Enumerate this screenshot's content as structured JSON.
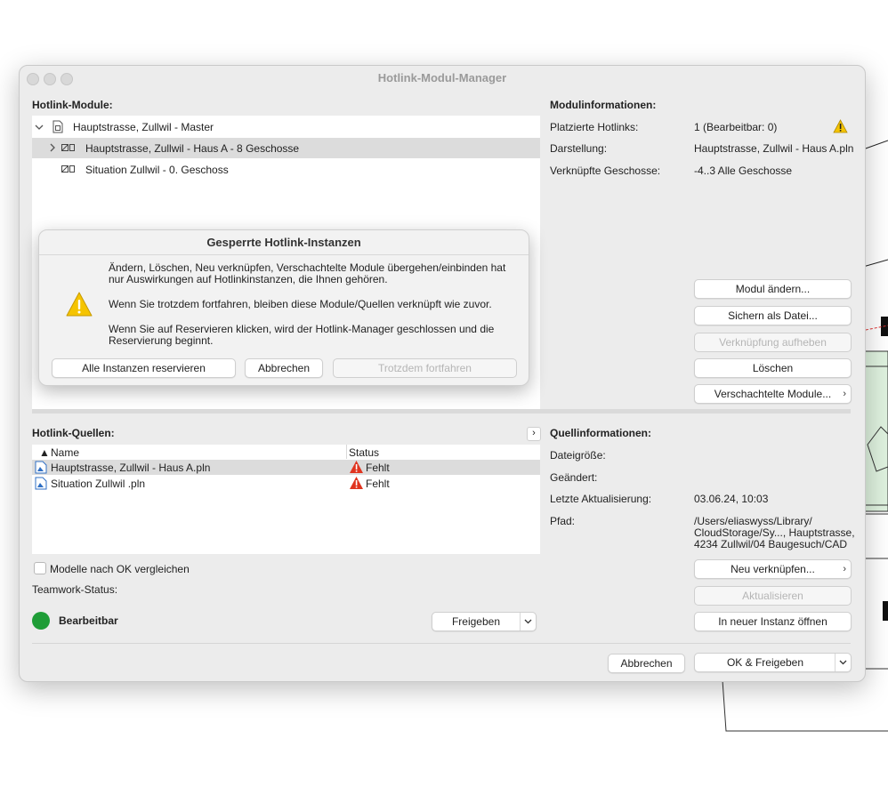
{
  "window": {
    "title": "Hotlink-Modul-Manager"
  },
  "modules": {
    "label": "Hotlink-Module:",
    "items": [
      {
        "name": "Hauptstrasse, Zullwil - Master"
      },
      {
        "name": "Hauptstrasse, Zullwil - Haus A - 8 Geschosse"
      },
      {
        "name": "Situation Zullwil  - 0. Geschoss"
      }
    ]
  },
  "module_info": {
    "label": "Modulinformationen:",
    "rows": [
      {
        "key": "Platzierte Hotlinks:",
        "value": "1 (Bearbeitbar: 0)"
      },
      {
        "key": "Darstellung:",
        "value": "Hauptstrasse, Zullwil - Haus A.pln"
      },
      {
        "key": "Verknüpfte Geschosse:",
        "value": "-4..3 Alle Geschosse"
      }
    ],
    "buttons": {
      "change": "Modul ändern...",
      "save": "Sichern als Datei...",
      "unlink": "Verknüpfung aufheben",
      "delete": "Löschen",
      "nested": "Verschachtelte Module..."
    }
  },
  "dialog": {
    "title": "Gesperrte Hotlink-Instanzen",
    "p1": "Ändern, Löschen, Neu verknüpfen, Verschachtelte Module übergehen/einbinden hat nur Auswirkungen auf Hotlinkinstanzen, die Ihnen gehören.",
    "p2": "Wenn Sie trotzdem fortfahren, bleiben diese Module/Quellen verknüpft wie zuvor.",
    "p3": "Wenn Sie auf Reservieren klicken, wird der Hotlink-Manager geschlossen und die Reservierung beginnt.",
    "btn_reserve": "Alle Instanzen reservieren",
    "btn_cancel": "Abbrechen",
    "btn_continue": "Trotzdem fortfahren"
  },
  "sources": {
    "label": "Hotlink-Quellen:",
    "col_name": "Name",
    "col_status": "Status",
    "rows": [
      {
        "name": "Hauptstrasse, Zullwil - Haus A.pln",
        "status": "Fehlt"
      },
      {
        "name": "Situation Zullwil .pln",
        "status": "Fehlt"
      }
    ],
    "compare_label": "Modelle nach OK vergleichen",
    "teamwork_label": "Teamwork-Status:",
    "status_text": "Bearbeitbar",
    "release_btn": "Freigeben"
  },
  "source_info": {
    "label": "Quellinformationen:",
    "size_key": "Dateigröße:",
    "changed_key": "Geändert:",
    "update_key": "Letzte Aktualisierung:",
    "update_value": "03.06.24, 10:03",
    "path_key": "Pfad:",
    "path_line1": "/Users/eliaswyss/Library/",
    "path_line2": "CloudStorage/Sy..., Hauptstrasse,",
    "path_line3": "4234 Zullwil/04 Baugesuch/CAD",
    "buttons": {
      "relink": "Neu verknüpfen...",
      "update": "Aktualisieren",
      "open_new": "In neuer Instanz öffnen"
    }
  },
  "footer": {
    "cancel": "Abbrechen",
    "ok": "OK & Freigeben"
  },
  "colors": {
    "status_green": "#1f9d37",
    "warning_yellow": "#f5c400",
    "error_red": "#e0341f"
  }
}
